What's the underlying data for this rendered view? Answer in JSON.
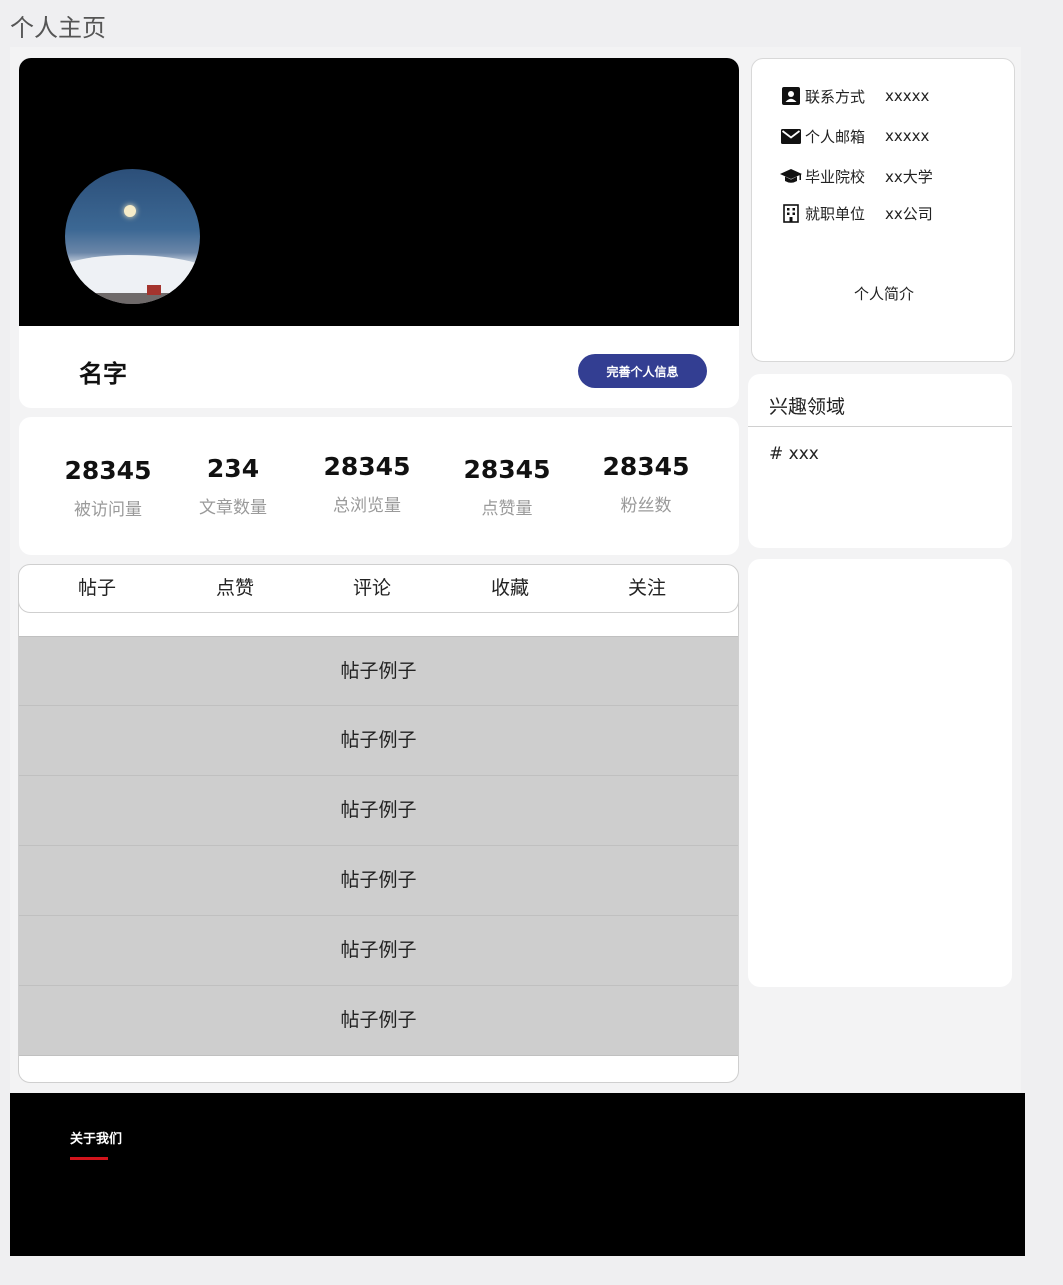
{
  "page": {
    "title": "个人主页"
  },
  "profile": {
    "name": "名字",
    "edit_button": "完善个人信息",
    "avatar_alt": "avatar"
  },
  "stats": [
    {
      "value": "28345",
      "label": "被访问量"
    },
    {
      "value": "234",
      "label": "文章数量"
    },
    {
      "value": "28345",
      "label": "总浏览量"
    },
    {
      "value": "28345",
      "label": "点赞量"
    },
    {
      "value": "28345",
      "label": "粉丝数"
    }
  ],
  "tabs": [
    "帖子",
    "点赞",
    "评论",
    "收藏",
    "关注"
  ],
  "posts": [
    "帖子例子",
    "帖子例子",
    "帖子例子",
    "帖子例子",
    "帖子例子",
    "帖子例子"
  ],
  "info": {
    "rows": [
      {
        "icon": "contact-card-icon",
        "key": "联系方式",
        "value": "xxxxx"
      },
      {
        "icon": "mail-icon",
        "key": "个人邮箱",
        "value": "xxxxx"
      },
      {
        "icon": "graduation-cap-icon",
        "key": "毕业院校",
        "value": "xx大学"
      },
      {
        "icon": "building-icon",
        "key": "就职单位",
        "value": "xx公司"
      }
    ],
    "intro_label": "个人简介"
  },
  "interests": {
    "title": "兴趣领域",
    "tag": "# xxx"
  },
  "footer": {
    "title": "关于我们",
    "accent_color": "#d2141c"
  },
  "colors": {
    "primary_button": "#333e92",
    "post_row_bg": "#cecece"
  }
}
